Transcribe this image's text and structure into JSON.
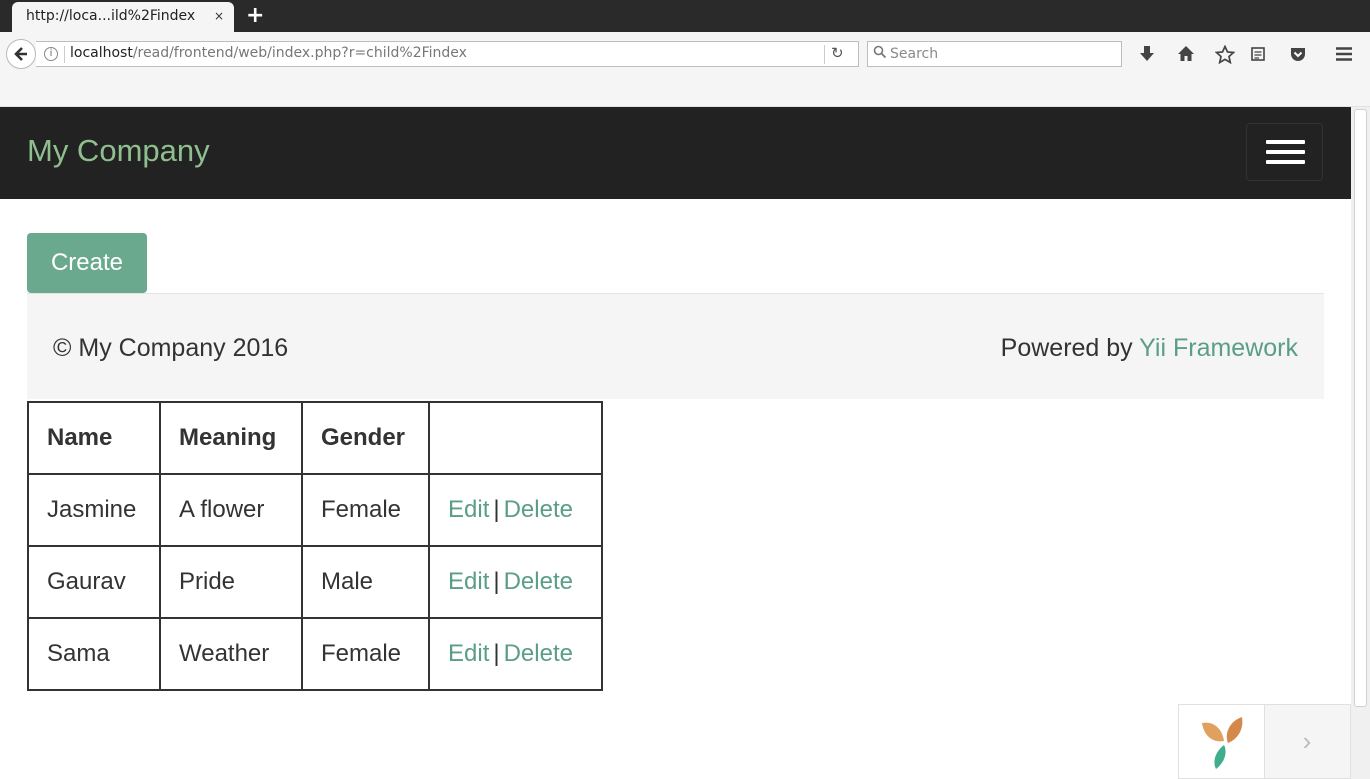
{
  "browser": {
    "tab_title": "http://loca...ild%2Findex",
    "tab_close": "×",
    "new_tab": "+",
    "url_host": "localhost",
    "url_path": "/read/frontend/web/index.php?r=child%2Findex",
    "search_placeholder": "Search",
    "reload_glyph": "↻"
  },
  "site": {
    "brand": "My Company",
    "create_label": "Create",
    "accent_color": "#6aa98e",
    "link_color": "#5a9e86"
  },
  "footer": {
    "copyright": "© My Company 2016",
    "powered_prefix": "Powered by ",
    "powered_link": "Yii Framework"
  },
  "table": {
    "headers": [
      "Name",
      "Meaning",
      "Gender",
      ""
    ],
    "rows": [
      {
        "name": "Jasmine",
        "meaning": "A flower",
        "gender": "Female",
        "edit": "Edit",
        "sep": "|",
        "delete": "Delete"
      },
      {
        "name": "Gaurav",
        "meaning": "Pride",
        "gender": "Male",
        "edit": "Edit",
        "sep": "|",
        "delete": "Delete"
      },
      {
        "name": "Sama",
        "meaning": "Weather",
        "gender": "Female",
        "edit": "Edit",
        "sep": "|",
        "delete": "Delete"
      }
    ]
  },
  "debug_toolbar": {
    "arrow": "›"
  }
}
